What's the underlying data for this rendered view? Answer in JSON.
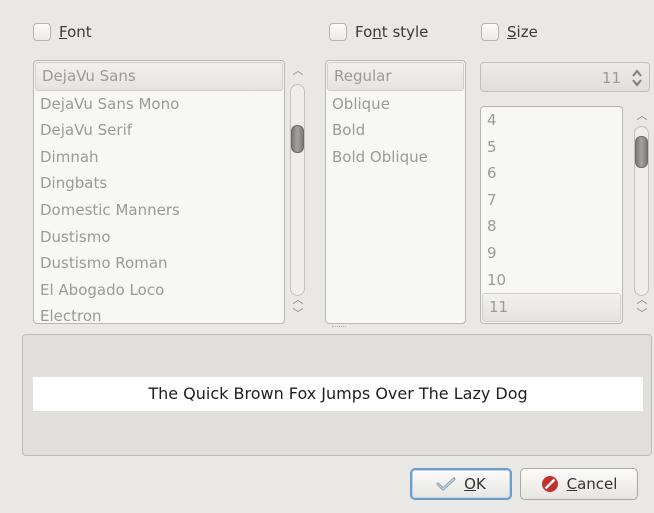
{
  "headers": {
    "font": {
      "label_pre": "",
      "label_u": "F",
      "label_post": "ont"
    },
    "font_style": {
      "label_pre": "Fo",
      "label_u": "n",
      "label_post": "t style"
    },
    "size": {
      "label_pre": "",
      "label_u": "S",
      "label_post": "ize"
    }
  },
  "font_list": [
    "DejaVu Sans",
    "DejaVu Sans Mono",
    "DejaVu Serif",
    "Dimnah",
    "Dingbats",
    "Domestic Manners",
    "Dustismo",
    "Dustismo Roman",
    "El Abogado Loco",
    "Electron"
  ],
  "font_selected": "DejaVu Sans",
  "style_list": [
    "Regular",
    "Oblique",
    "Bold",
    "Bold Oblique"
  ],
  "style_selected": "Regular",
  "size_value": "11",
  "size_list": [
    "4",
    "5",
    "6",
    "7",
    "8",
    "9",
    "10",
    "11"
  ],
  "size_selected": "11",
  "preview_text": "The Quick Brown Fox Jumps Over The Lazy Dog",
  "buttons": {
    "ok": {
      "label_u": "O",
      "label_post": "K"
    },
    "cancel": {
      "label_u": "C",
      "label_post": "ancel"
    }
  },
  "icons": {
    "ok": "checkmark-icon",
    "cancel": "stop-icon",
    "spin": "up-down-arrows-icon"
  }
}
